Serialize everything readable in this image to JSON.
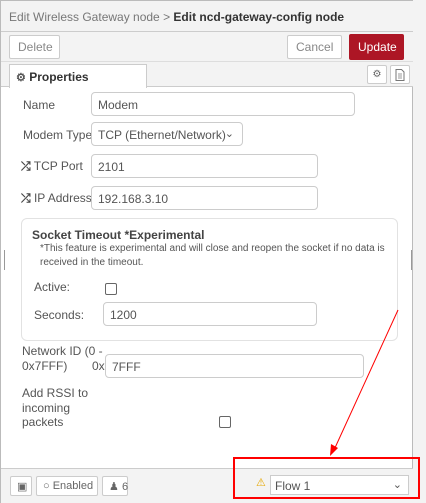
{
  "header": {
    "parent": "Edit Wireless Gateway node",
    "separator": " > ",
    "current": "Edit ncd-gateway-config node"
  },
  "toolbar": {
    "delete_label": "Delete",
    "cancel_label": "Cancel",
    "update_label": "Update"
  },
  "tabs": {
    "properties_label": "Properties"
  },
  "form": {
    "name_label": "Name",
    "name_value": "Modem",
    "modem_type_label": "Modem Type",
    "modem_type_value": "TCP (Ethernet/Network)",
    "tcp_port_label": "TCP Port",
    "tcp_port_value": "2101",
    "ip_address_label": "IP Address",
    "ip_address_value": "192.168.3.10",
    "socket": {
      "title": "Socket Timeout *Experimental",
      "note_line1": "*This feature is experimental and will close and reopen the socket if no data is",
      "note_line2": "received in the timeout.",
      "active_label": "Active:",
      "active_checked": false,
      "seconds_label": "Seconds:",
      "seconds_value": "1200"
    },
    "network_id_label_line1": "Network ID (0 -",
    "network_id_label_line2": "0x7FFF)",
    "network_id_prefix": "0x",
    "network_id_value": "7FFF",
    "rssi_label_line1": "Add RSSI to",
    "rssi_label_line2": "incoming",
    "rssi_label_line3": "packets",
    "rssi_checked": false
  },
  "footer": {
    "enabled_label": "Enabled",
    "user_count": "6",
    "flow_label": "Flow 1"
  },
  "colors": {
    "accent": "#ad1625",
    "annotation": "#ff0000",
    "warning": "#e6a700"
  }
}
